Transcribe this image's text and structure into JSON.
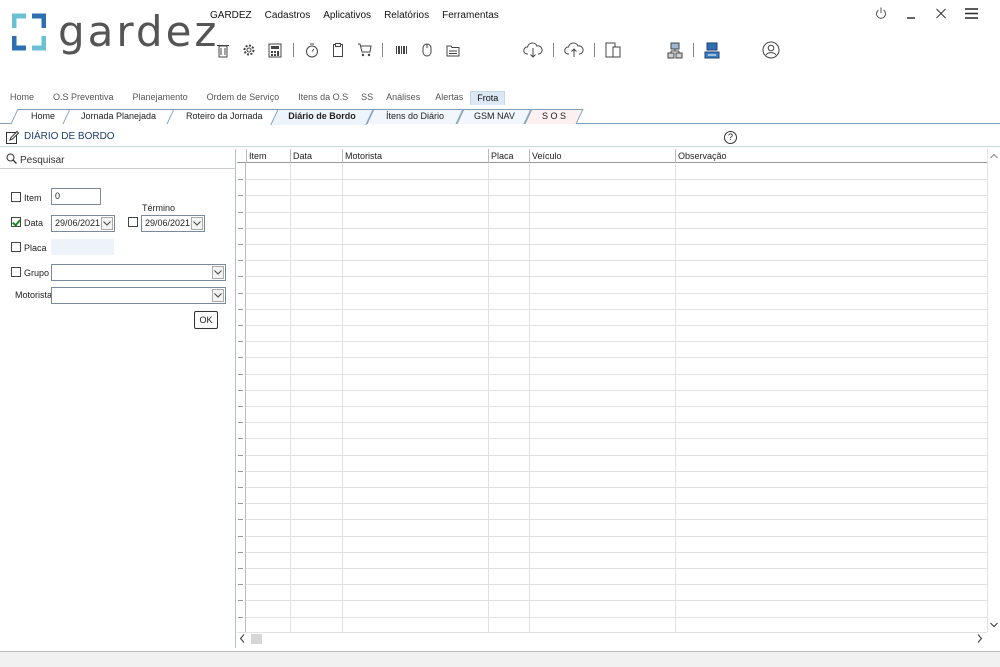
{
  "app": {
    "logo_text": "gardez",
    "colors": {
      "brand_blue": "#2e6fb3",
      "brand_teal": "#6bc1d4",
      "accent": "#1e3c6e"
    }
  },
  "menu": [
    "GARDEZ",
    "Cadastros",
    "Aplicativos",
    "Relatórios",
    "Ferramentas"
  ],
  "toolbar_icons": [
    "trash-icon",
    "gear-icon",
    "calculator-icon",
    "stopwatch-icon",
    "clipboard-icon",
    "cart-icon",
    "barcode-icon",
    "mouse-icon",
    "folder-icon",
    "cloud-download-icon",
    "cloud-upload-icon",
    "devices-icon",
    "network-icon",
    "sync-icon",
    "user-icon"
  ],
  "window_controls": [
    "power-icon",
    "minimize-icon",
    "close-icon",
    "hamburger-icon"
  ],
  "modules": [
    "Home",
    "O.S Preventiva",
    "Planejamento",
    "Ordem de Serviço",
    "Itens da O.S",
    "SS",
    "Análises",
    "Alertas",
    "Frota"
  ],
  "active_module": "Frota",
  "tabs": [
    "Home",
    "Jornada Planejada",
    "Roteiro da Jornada",
    "Diário de Bordo",
    "Ítens do Diário",
    "GSM NAV",
    "S O S"
  ],
  "active_tab": "Diário de Bordo",
  "section": {
    "title": "DIÁRIO DE BORDO",
    "help": "?"
  },
  "search": {
    "label": "Pesquisar",
    "item_label": "Item",
    "item_value": "0",
    "item_checked": false,
    "data_label": "Data",
    "data_checked": true,
    "data_value": "29/06/2021",
    "termino_label": "Término",
    "termino_checked": false,
    "termino_value": "29/06/2021",
    "placa_label": "Placa",
    "placa_checked": false,
    "grupo_label": "Grupo",
    "grupo_checked": false,
    "grupo_value": "",
    "motorista_label": "Motorista",
    "motorista_value": "",
    "ok_label": "OK"
  },
  "grid": {
    "columns": [
      "Item",
      "Data",
      "Motorista",
      "Placa",
      "Veículo",
      "Observação"
    ],
    "rows": []
  }
}
